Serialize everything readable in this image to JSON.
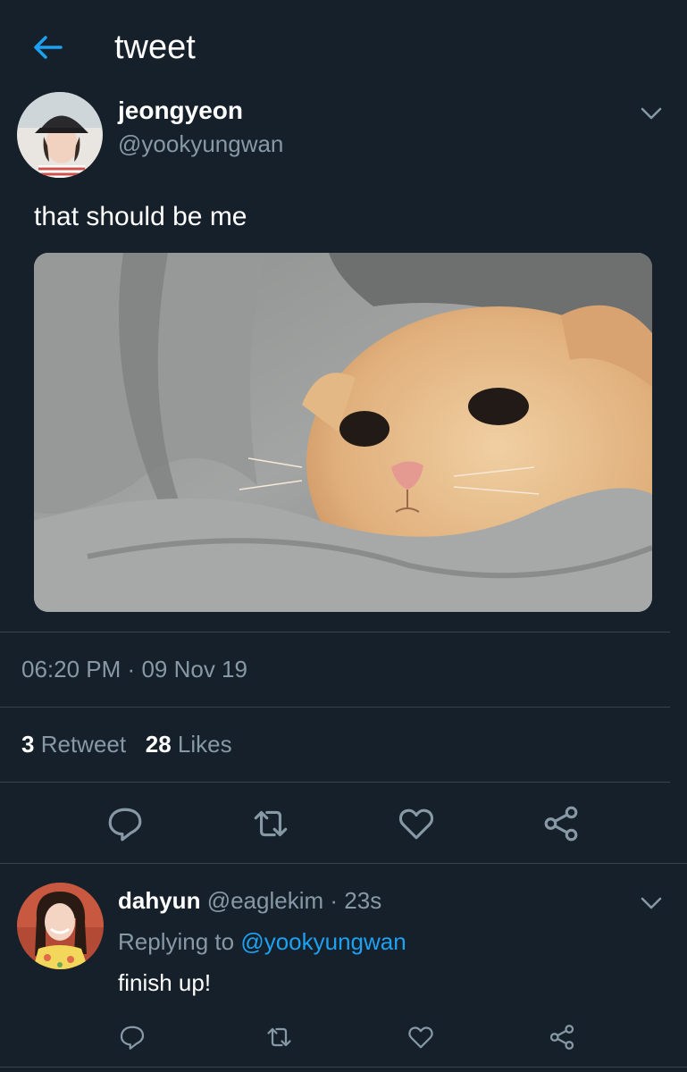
{
  "header": {
    "title": "tweet",
    "back_icon": "arrow-left-icon",
    "accent": "#1da1f2"
  },
  "tweet": {
    "author_name": "jeongyeon",
    "author_handle": "@yookyungwan",
    "text": "that should be me",
    "media_alt": "orange kitten nestled in gray hoodie",
    "time": "06:20 PM",
    "separator": "·",
    "date": "09 Nov 19",
    "retweet_count": "3",
    "retweet_label": "Retweet",
    "like_count": "28",
    "like_label": "Likes",
    "actions": [
      "comment-icon",
      "retweet-icon",
      "heart-icon",
      "share-icon"
    ]
  },
  "reply": {
    "author_name": "dahyun",
    "author_handle": "@eaglekim",
    "separator": "·",
    "age": "23s",
    "replying_prefix": "Replying to",
    "replying_handle": "@yookyungwan",
    "text": "finish up!",
    "actions": [
      "comment-icon",
      "retweet-icon",
      "heart-icon",
      "share-icon"
    ]
  },
  "colors": {
    "background": "#15202b",
    "secondary_text": "#8899a6",
    "divider": "#38444d",
    "link": "#1da1f2"
  }
}
